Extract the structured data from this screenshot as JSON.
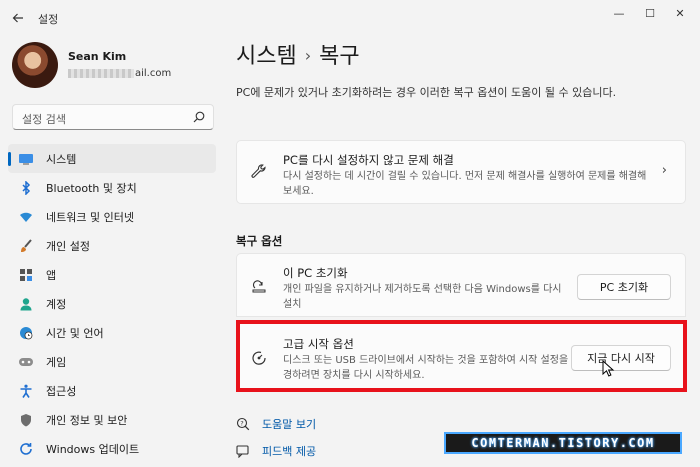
{
  "window": {
    "title": "설정",
    "back_icon": "back-arrow-icon",
    "minimize_glyph": "—",
    "maximize_glyph": "☐",
    "close_glyph": "✕"
  },
  "profile": {
    "name": "Sean Kim",
    "email_suffix": "ail.com"
  },
  "search": {
    "placeholder": "설정 검색"
  },
  "sidebar": {
    "items": [
      {
        "label": "시스템",
        "icon": "system-icon",
        "active": true
      },
      {
        "label": "Bluetooth 및 장치",
        "icon": "bluetooth-icon"
      },
      {
        "label": "네트워크 및 인터넷",
        "icon": "wifi-icon"
      },
      {
        "label": "개인 설정",
        "icon": "brush-icon"
      },
      {
        "label": "앱",
        "icon": "apps-icon"
      },
      {
        "label": "계정",
        "icon": "account-icon"
      },
      {
        "label": "시간 및 언어",
        "icon": "globe-clock-icon"
      },
      {
        "label": "게임",
        "icon": "gamepad-icon"
      },
      {
        "label": "접근성",
        "icon": "accessibility-icon"
      },
      {
        "label": "개인 정보 및 보안",
        "icon": "shield-icon"
      },
      {
        "label": "Windows 업데이트",
        "icon": "update-icon"
      }
    ]
  },
  "main": {
    "breadcrumb_parent": "시스템",
    "breadcrumb_sep": "›",
    "breadcrumb_current": "복구",
    "description": "PC에 문제가 있거나 초기화하려는 경우 이러한 복구 옵션이 도움이 될 수 있습니다.",
    "troubleshoot_card": {
      "title": "PC를 다시 설정하지 않고 문제 해결",
      "description": "다시 설정하는 데 시간이 걸릴 수 있습니다. 먼저 문제 해결사를 실행하여 문제를 해결해 보세요.",
      "chevron": "›"
    },
    "section_title": "복구 옵션",
    "reset_card": {
      "title": "이 PC 초기화",
      "description": "개인 파일을 유지하거나 제거하도록 선택한 다음 Windows를 다시 설치",
      "button": "PC 초기화"
    },
    "advanced_card": {
      "title": "고급 시작 옵션",
      "description": "디스크 또는 USB 드라이브에서 시작하는 것을 포함하여 시작 설정을 변경하려면 장치를 다시 시작하세요.",
      "button": "지금 다시 시작"
    },
    "links": [
      {
        "label": "도움말 보기",
        "icon": "help-icon"
      },
      {
        "label": "피드백 제공",
        "icon": "feedback-icon"
      }
    ]
  },
  "watermark": "COMTERMAN.TISTORY.COM",
  "colors": {
    "accent": "#0067c0",
    "highlight": "#e8121b",
    "background": "#f3f3f3",
    "link": "#0058a8"
  }
}
